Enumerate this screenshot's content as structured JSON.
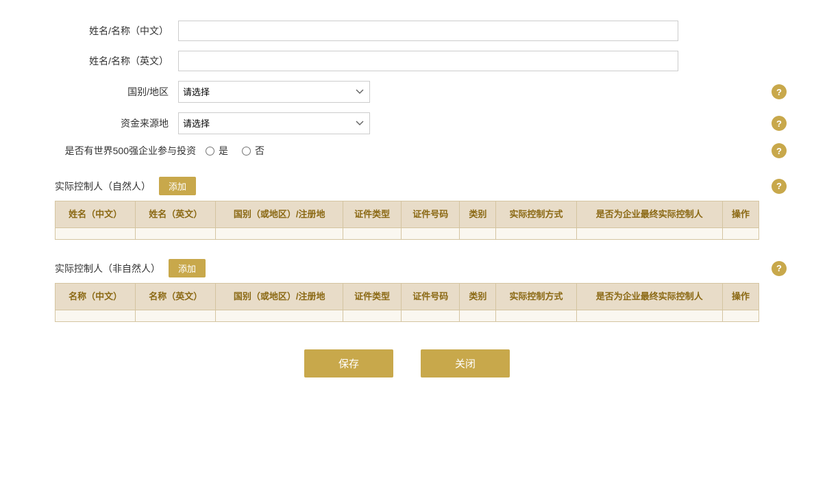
{
  "form": {
    "name_cn_label": "姓名/名称（中文）",
    "name_en_label": "姓名/名称（英文）",
    "country_label": "国别/地区",
    "fund_source_label": "资金来源地",
    "world500_label": "是否有世界500强企业参与投资",
    "select_placeholder": "请选择",
    "radio_yes": "是",
    "radio_no": "否"
  },
  "section1": {
    "title": "实际控制人（自然人）",
    "add_label": "添加",
    "columns": [
      "姓名（中文）",
      "姓名（英文）",
      "国别（或地区）/注册地",
      "证件类型",
      "证件号码",
      "类别",
      "实际控制方式",
      "是否为企业最终实际控制人",
      "操作"
    ]
  },
  "section2": {
    "title": "实际控制人（非自然人）",
    "add_label": "添加",
    "columns": [
      "名称（中文）",
      "名称（英文）",
      "国别（或地区）/注册地",
      "证件类型",
      "证件号码",
      "类别",
      "实际控制方式",
      "是否为企业最终实际控制人",
      "操作"
    ]
  },
  "buttons": {
    "save": "保存",
    "close": "关闭"
  },
  "help": {
    "label": "?"
  }
}
